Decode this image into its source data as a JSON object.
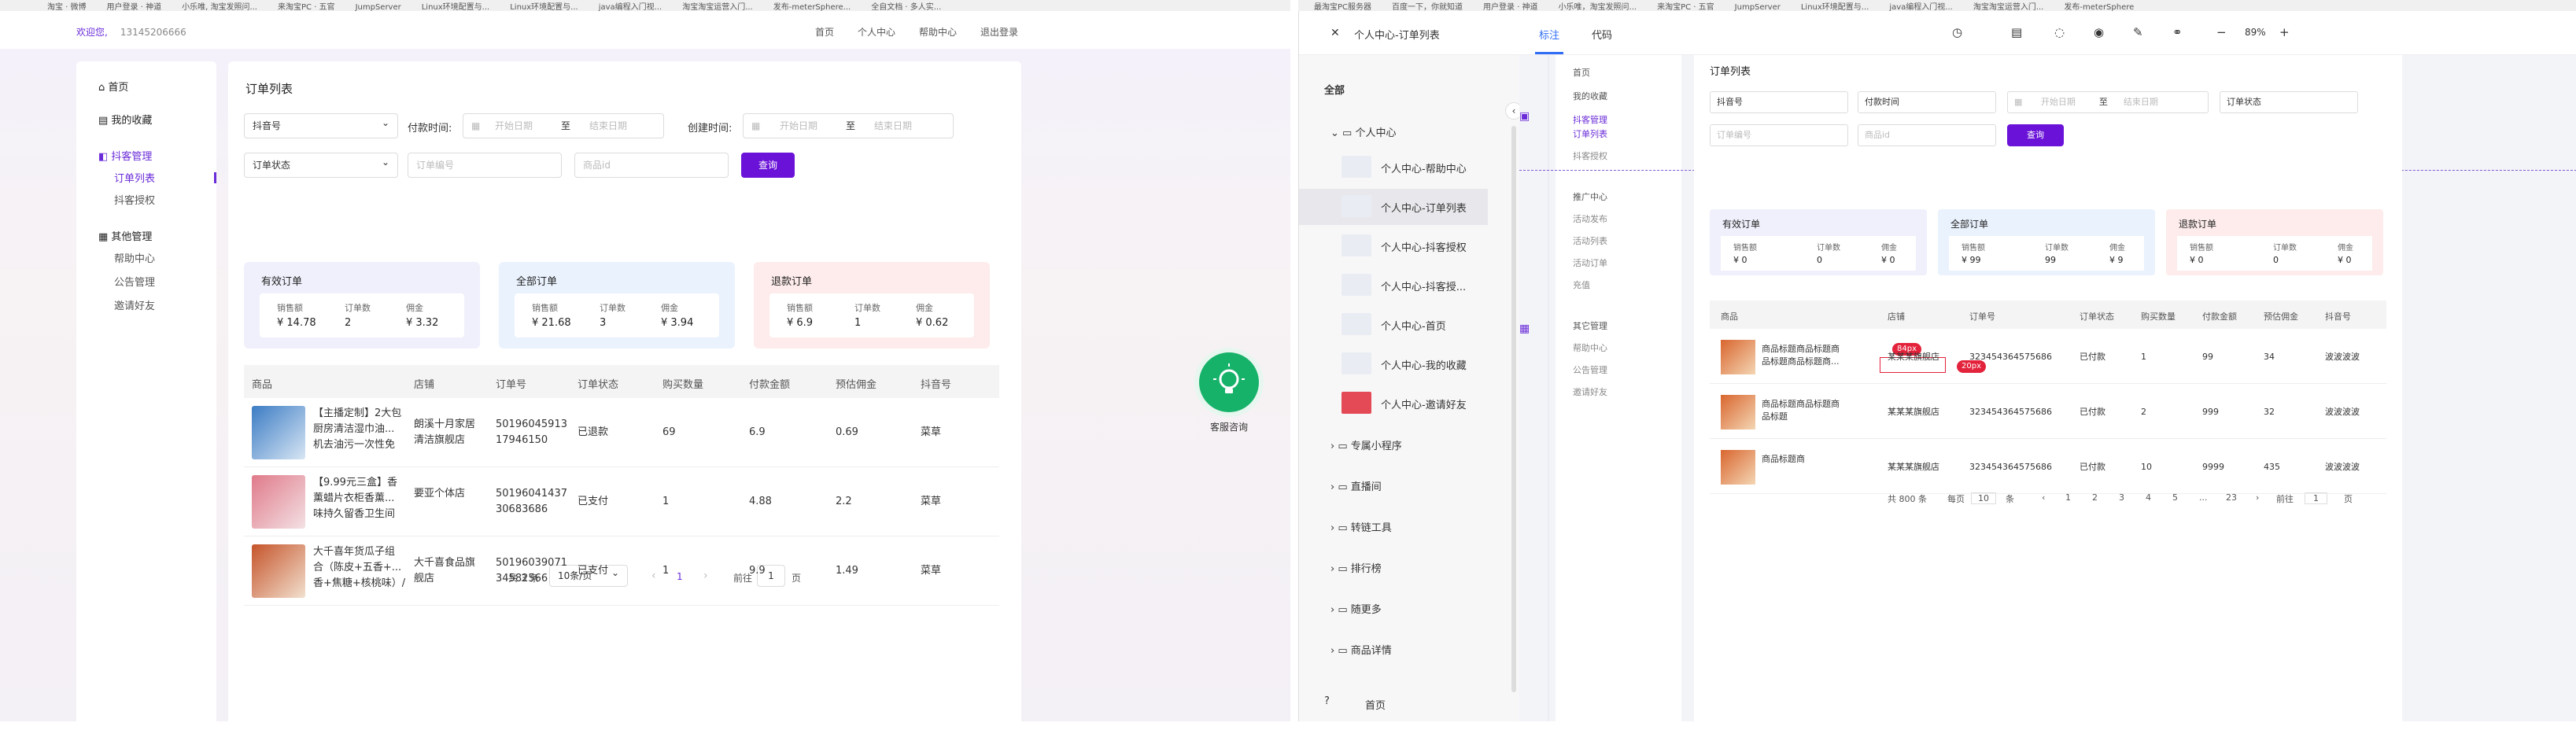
{
  "bookmarks_left": [
    "淘宝 · 微博",
    "用户登录 · 神道",
    "小乐唯, 淘宝发照问...",
    "来淘宝PC · 五官",
    "JumpServer",
    "Linux环境配置与...",
    "Linux环境配置与...",
    "java编程入门视...",
    "淘宝淘宝运营入门...",
    "发布-meterSphere...",
    "全自文档 · 多人实..."
  ],
  "bookmarks_right": [
    "最淘宝PC服务器",
    "百度一下，你就知道",
    "用户登录 · 神道",
    "小乐唯，淘宝发照问...",
    "来淘宝PC · 五官",
    "JumpServer",
    "Linux环境配置与...",
    "java编程入门视...",
    "淘宝淘宝运营入门...",
    "发布-meterSphere"
  ],
  "header": {
    "welcome": "欢迎您,",
    "phone": "13145206666",
    "nav": [
      "首页",
      "个人中心",
      "帮助中心",
      "退出登录"
    ]
  },
  "sidebar": {
    "home": "首页",
    "fav": "我的收藏",
    "douke": "抖客管理",
    "order_list": "订单列表",
    "douyin_auth": "抖客授权",
    "other": "其他管理",
    "help": "帮助中心",
    "notice": "公告管理",
    "invite": "邀请好友"
  },
  "page": {
    "title": "订单列表"
  },
  "filters": {
    "platform": "抖音号",
    "pay_time_label": "付款时间:",
    "start_ph": "开始日期",
    "to": "至",
    "end_ph": "结束日期",
    "create_time_label": "创建时间:",
    "status": "订单状态",
    "order_no_ph": "订单编号",
    "goods_id_ph": "商品id",
    "query": "查询"
  },
  "cards": [
    {
      "title": "有效订单",
      "bg": "#f0f0fc",
      "stats": [
        {
          "k": "销售额",
          "v": "¥ 14.78"
        },
        {
          "k": "订单数",
          "v": "2"
        },
        {
          "k": "佣金",
          "v": "¥ 3.32"
        }
      ]
    },
    {
      "title": "全部订单",
      "bg": "#eaf2fd",
      "stats": [
        {
          "k": "销售额",
          "v": "¥ 21.68"
        },
        {
          "k": "订单数",
          "v": "3"
        },
        {
          "k": "佣金",
          "v": "¥ 3.94"
        }
      ]
    },
    {
      "title": "退款订单",
      "bg": "#fdeceb",
      "stats": [
        {
          "k": "销售额",
          "v": "¥ 6.9"
        },
        {
          "k": "订单数",
          "v": "1"
        },
        {
          "k": "佣金",
          "v": "¥ 0.62"
        }
      ]
    }
  ],
  "table": {
    "headers": [
      "商品",
      "店铺",
      "订单号",
      "订单状态",
      "购买数量",
      "付款金额",
      "预估佣金",
      "抖音号"
    ],
    "rows": [
      {
        "p1": "【主播定制】2大包",
        "p2": "厨房清洁湿巾油...",
        "p3": "机去油污一次性免",
        "shop1": "朗溪十月家居",
        "shop2": "清洁旗舰店",
        "no1": "50196045913",
        "no2": "17946150",
        "status": "已退款",
        "qty": "69",
        "pay": "6.9",
        "comm": "0.69",
        "dy": "菜草"
      },
      {
        "p1": "【9.99元三盒】香",
        "p2": "薰蜡片衣柜香薰...",
        "p3": "味持久留香卫生间",
        "shop1": "要亚个体店",
        "shop2": "",
        "no1": "50196041437",
        "no2": "30683686",
        "status": "已支付",
        "qty": "1",
        "pay": "4.88",
        "comm": "2.2",
        "dy": "菜草"
      },
      {
        "p1": "大千喜年货瓜子组",
        "p2": "合（陈皮+五香+...",
        "p3": "香+焦糖+核桃味）/",
        "shop1": "大千喜食品旗",
        "shop2": "舰店",
        "no1": "50196039071",
        "no2": "34582566",
        "status": "已支付",
        "qty": "1",
        "pay": "9.9",
        "comm": "1.49",
        "dy": "菜草"
      }
    ]
  },
  "pager": {
    "total": "共 3 条",
    "size": "10条/页",
    "prev": "‹",
    "page": "1",
    "next": "›",
    "goto": "前往",
    "goto_val": "1",
    "page_unit": "页"
  },
  "chat": {
    "label": "客服咨询"
  },
  "right_top": {
    "close": "✕",
    "title": "个人中心-订单列表",
    "tab_mark": "标注",
    "tab_code": "代码",
    "zoom": "89%",
    "minus": "−",
    "plus": "+"
  },
  "tree": {
    "all": "全部",
    "folder": "个人中心",
    "items": [
      "个人中心-帮助中心",
      "个人中心-订单列表",
      "个人中心-抖客授权",
      "个人中心-抖客授...",
      "个人中心-首页",
      "个人中心-我的收藏",
      "个人中心-邀请好友"
    ],
    "folders": [
      "专属小程序",
      "直播间",
      "转链工具",
      "排行榜",
      "随更多",
      "商品详情"
    ],
    "last": "首页",
    "help": "?"
  },
  "rside": {
    "home": "首页",
    "fav": "我的收藏",
    "douke": "抖客管理",
    "order_list": "订单列表",
    "auth": "抖客授权",
    "promo": "推广中心",
    "act_pub": "活动发布",
    "act_list": "活动列表",
    "act_order": "活动订单",
    "recharge": "充值",
    "other": "其它管理",
    "help": "帮助中心",
    "notice": "公告管理",
    "invite": "邀请好友"
  },
  "rpage": {
    "title": "订单列表",
    "platform": "抖音号",
    "pay": "付款时间",
    "start": "开始日期",
    "to": "至",
    "end": "结束日期",
    "status": "订单状态",
    "order_ph": "订单编号",
    "goods_ph": "商品id",
    "query": "查询"
  },
  "rcards": [
    {
      "title": "有效订单",
      "bg": "#f0f0fc",
      "stats": [
        {
          "k": "销售额",
          "v": "¥ 0"
        },
        {
          "k": "订单数",
          "v": "0"
        },
        {
          "k": "佣金",
          "v": "¥ 0"
        }
      ]
    },
    {
      "title": "全部订单",
      "bg": "#eaf2fd",
      "stats": [
        {
          "k": "销售额",
          "v": "¥ 99"
        },
        {
          "k": "订单数",
          "v": "99"
        },
        {
          "k": "佣金",
          "v": "¥ 9"
        }
      ]
    },
    {
      "title": "退款订单",
      "bg": "#fdeceb",
      "stats": [
        {
          "k": "销售额",
          "v": "¥ 0"
        },
        {
          "k": "订单数",
          "v": "0"
        },
        {
          "k": "佣金",
          "v": "¥ 0"
        }
      ]
    }
  ],
  "rtable": {
    "headers": [
      "商品",
      "店铺",
      "订单号",
      "订单状态",
      "购买数量",
      "付款金额",
      "预估佣金",
      "抖音号"
    ],
    "rows": [
      {
        "p1": "商品标题商品标题商",
        "p2": "品标题商品标题商...",
        "shop": "某某某旗舰店",
        "no": "323454364575686",
        "status": "已付款",
        "qty": "1",
        "pay": "99",
        "comm": "34",
        "dy": "波波波波"
      },
      {
        "p1": "商品标题商品标题商",
        "p2": "品标题",
        "shop": "某某某旗舰店",
        "no": "323454364575686",
        "status": "已付款",
        "qty": "2",
        "pay": "999",
        "comm": "32",
        "dy": "波波波波"
      },
      {
        "p1": "商品标题商",
        "p2": "",
        "shop": "某某某旗舰店",
        "no": "323454364575686",
        "status": "已付款",
        "qty": "10",
        "pay": "9999",
        "comm": "435",
        "dy": "波波波波"
      }
    ],
    "badge1": "84px",
    "badge2": "20px"
  },
  "rpager": {
    "total": "共 800 条",
    "per": "每页",
    "size": "10",
    "unit": "条",
    "prev": "‹",
    "pages": [
      "1",
      "2",
      "3",
      "4",
      "5",
      "...",
      "23"
    ],
    "next": "›",
    "goto": "前往",
    "goto_val": "1",
    "page_unit": "页"
  }
}
